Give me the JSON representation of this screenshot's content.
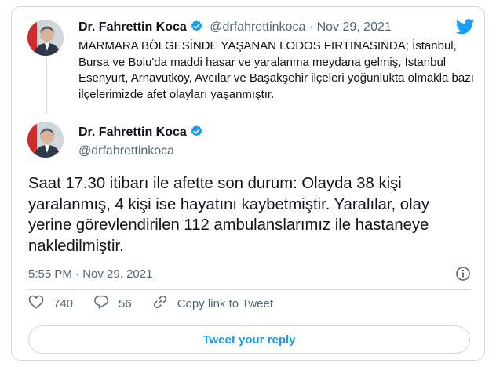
{
  "quoted_tweet": {
    "display_name": "Dr. Fahrettin Koca",
    "handle": "@drfahrettinkoca",
    "separator": "·",
    "date": "Nov 29, 2021",
    "text": "MARMARA BÖLGESİNDE YAŞANAN LODOS FIRTINASINDA; İstanbul, Bursa ve Bolu'da maddi hasar ve yaralanma meydana gelmiş, İstanbul Esenyurt, Arnavutköy, Avcılar ve Başakşehir ilçeleri yoğunlukta olmakla bazı ilçelerimizde afet olayları yaşanmıştır."
  },
  "main_tweet": {
    "display_name": "Dr. Fahrettin Koca",
    "handle": "@drfahrettinkoca",
    "text": "Saat 17.30 itibarı ile afette son durum: Olayda 38 kişi yaralanmış, 4 kişi ise hayatını kaybetmiştir. Yaralılar, olay yerine görevlendirilen 112 ambulanslarımız ile hastaneye nakledilmiştir.",
    "timestamp": "5:55 PM · Nov 29, 2021"
  },
  "actions": {
    "like_count": "740",
    "reply_count": "56",
    "copy_link_label": "Copy link to Tweet"
  },
  "reply_button_label": "Tweet your reply",
  "icons": [
    "twitter-bird-icon",
    "verified-badge-icon",
    "info-icon",
    "heart-icon",
    "reply-bubble-icon",
    "link-icon"
  ],
  "colors": {
    "accent": "#1d9bf0",
    "text": "#0f1419",
    "muted": "#536471",
    "border": "#cfd9de"
  }
}
